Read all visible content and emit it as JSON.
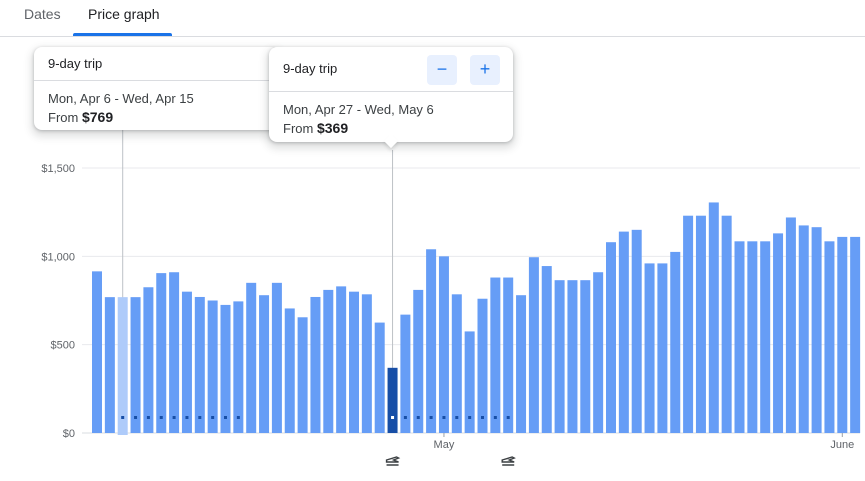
{
  "tabs": [
    {
      "label": "Dates",
      "active": false
    },
    {
      "label": "Price graph",
      "active": true
    }
  ],
  "tooltip_left": {
    "trip": "9-day trip",
    "dates": "Mon, Apr 6 - Wed, Apr 15",
    "from_label": "From",
    "price": "$769"
  },
  "tooltip_right": {
    "trip": "9-day trip",
    "dates": "Mon, Apr 27 - Wed, May 6",
    "from_label": "From",
    "price": "$369",
    "zoom_out": "−",
    "zoom_in": "+"
  },
  "colors": {
    "bar": "#669df6",
    "bar_selected": "#174ea6",
    "bar_hover": "#aecbfa",
    "accent": "#1a73e8",
    "grid": "#e8eaed"
  },
  "chart_data": {
    "type": "bar",
    "ylim": [
      0,
      1500
    ],
    "yticks": [
      {
        "value": 1500,
        "label": "$1,500"
      },
      {
        "value": 1000,
        "label": "$1,000"
      },
      {
        "value": 500,
        "label": "$500"
      },
      {
        "value": 0,
        "label": "$0"
      }
    ],
    "x_labels": [
      {
        "index": 27,
        "label": "May"
      },
      {
        "index": 58,
        "label": "June"
      }
    ],
    "values": [
      915,
      769,
      769,
      769,
      825,
      905,
      910,
      800,
      770,
      750,
      725,
      745,
      850,
      780,
      850,
      705,
      655,
      770,
      810,
      830,
      800,
      785,
      625,
      369,
      670,
      810,
      1040,
      1000,
      785,
      575,
      760,
      880,
      880,
      780,
      995,
      945,
      865,
      865,
      865,
      910,
      1080,
      1140,
      1150,
      960,
      960,
      1025,
      1230,
      1230,
      1305,
      1230,
      1085,
      1085,
      1085,
      1130,
      1220,
      1175,
      1165,
      1085,
      1110,
      1110
    ],
    "selected_index": 23,
    "hover_index": 2,
    "trip_range_left": [
      2,
      11
    ],
    "trip_range_right": [
      23,
      32
    ],
    "icons": [
      "takeoff-icon",
      "landing-icon"
    ]
  }
}
